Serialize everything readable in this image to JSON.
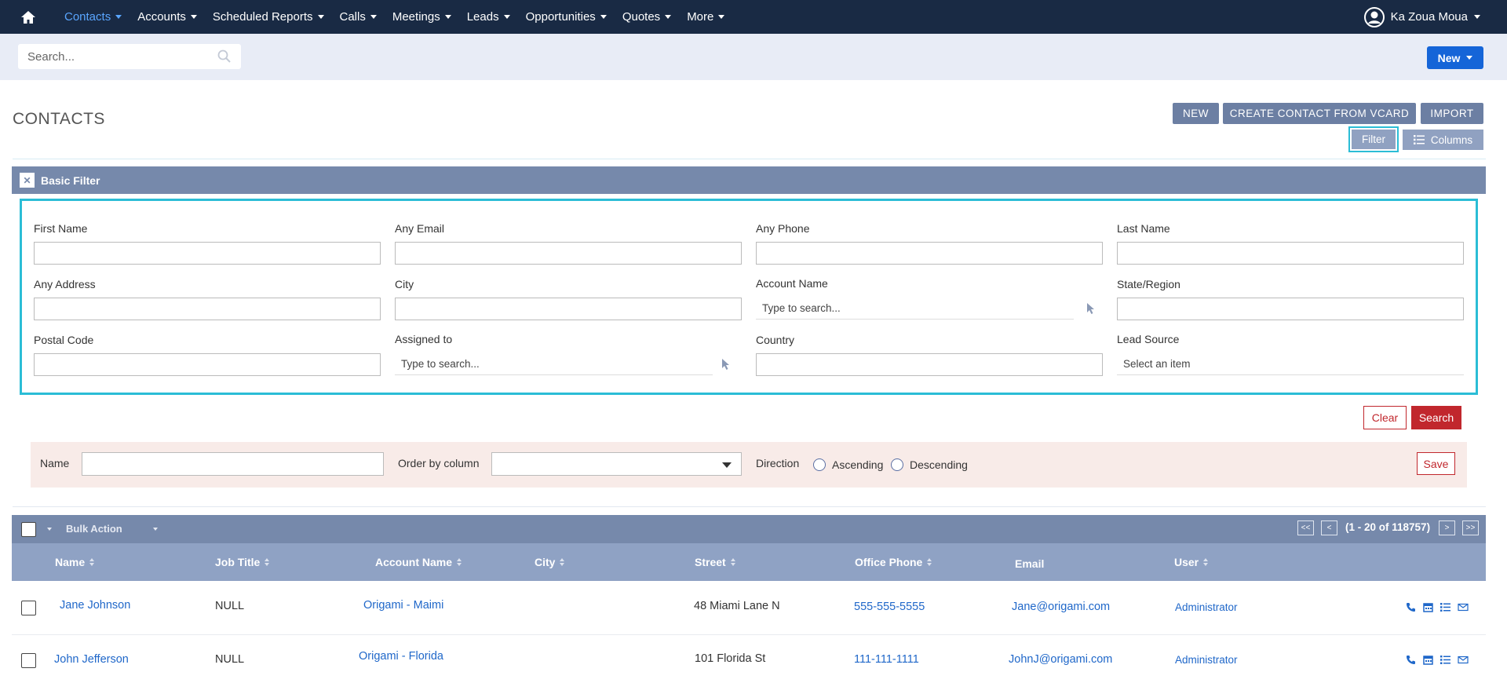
{
  "nav": {
    "items": [
      {
        "label": "Contacts",
        "active": true
      },
      {
        "label": "Accounts"
      },
      {
        "label": "Scheduled Reports"
      },
      {
        "label": "Calls"
      },
      {
        "label": "Meetings"
      },
      {
        "label": "Leads"
      },
      {
        "label": "Opportunities"
      },
      {
        "label": "Quotes"
      },
      {
        "label": "More"
      }
    ],
    "user_name": "Ka Zoua Moua"
  },
  "search": {
    "placeholder": "Search..."
  },
  "new_button": "New",
  "page_title": "CONTACTS",
  "header_buttons": {
    "new": "NEW",
    "vcard": "CREATE CONTACT FROM VCARD",
    "import": "IMPORT",
    "filter": "Filter",
    "columns": "Columns"
  },
  "filter": {
    "title": "Basic Filter",
    "fields": {
      "first_name": "First Name",
      "any_email": "Any Email",
      "any_phone": "Any Phone",
      "last_name": "Last Name",
      "any_address": "Any Address",
      "city": "City",
      "account_name": "Account Name",
      "state_region": "State/Region",
      "postal_code": "Postal Code",
      "assigned_to": "Assigned to",
      "country": "Country",
      "lead_source": "Lead Source"
    },
    "typeahead_placeholder": "Type to search...",
    "select_placeholder": "Select an item",
    "clear": "Clear",
    "search": "Search"
  },
  "saved_search": {
    "name_label": "Name",
    "order_label": "Order by column",
    "direction_label": "Direction",
    "ascending": "Ascending",
    "descending": "Descending",
    "save": "Save"
  },
  "list": {
    "bulk_action": "Bulk Action",
    "pagination": {
      "first": "<<",
      "prev": "<",
      "info": "(1 - 20 of 118757)",
      "next": ">",
      "last": ">>"
    },
    "columns": {
      "name": "Name",
      "job_title": "Job Title",
      "account_name": "Account Name",
      "city": "City",
      "street": "Street",
      "office_phone": "Office Phone",
      "email": "Email",
      "user": "User"
    },
    "rows": [
      {
        "name": "Jane Johnson",
        "job_title": "NULL",
        "account": "Origami - Maimi",
        "city": "",
        "street": "48 Miami Lane N",
        "phone": "555-555-5555",
        "email": "Jane@origami.com",
        "user": "Administrator"
      },
      {
        "name": "John Jefferson",
        "job_title": "NULL",
        "account": "Origami - Florida",
        "city": "",
        "street": "101 Florida St",
        "phone": "111-111-1111",
        "email": "JohnJ@origami.com",
        "user": "Administrator"
      }
    ]
  },
  "colors": {
    "nav_bg": "#192a44",
    "accent_blue": "#1565d8",
    "filter_header": "#7689ab",
    "highlight": "#2bbdd6",
    "danger": "#c1272d",
    "link": "#1f67c9"
  }
}
